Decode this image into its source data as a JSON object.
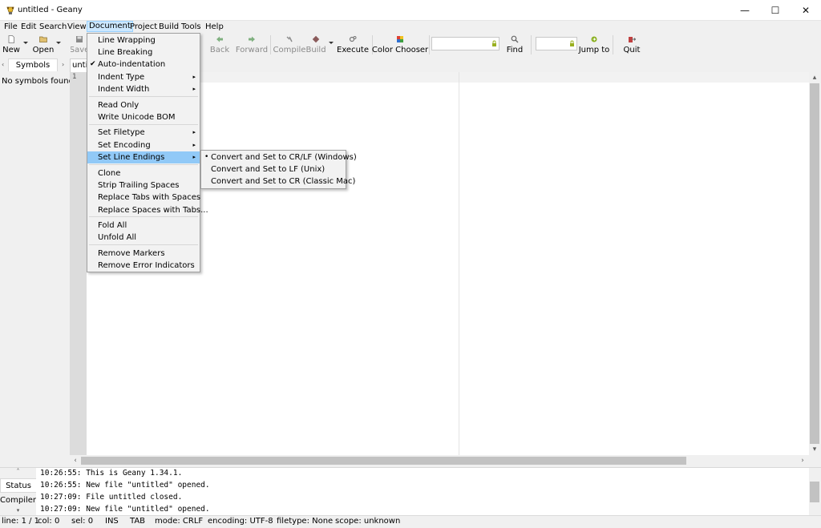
{
  "window": {
    "title": "untitled - Geany",
    "minimize": "—",
    "maximize": "☐",
    "close": "✕"
  },
  "menubar": [
    "File",
    "Edit",
    "Search",
    "View",
    "Document",
    "Project",
    "Build",
    "Tools",
    "Help"
  ],
  "toolbar": {
    "new": "New",
    "open": "Open",
    "save": "Save",
    "back": "Back",
    "forward": "Forward",
    "compile": "Compile",
    "build": "Build",
    "execute": "Execute",
    "color_chooser": "Color Chooser",
    "search_value": "",
    "find": "Find",
    "goto_value": "",
    "jump_to": "Jump to",
    "quit": "Quit"
  },
  "sidebar": {
    "tab": "Symbols",
    "empty_text": "No symbols found"
  },
  "editor": {
    "tab_label": "untitled",
    "line_number": "1"
  },
  "document_menu": {
    "items": [
      {
        "label": "Line Wrapping",
        "checked": false,
        "submenu": false
      },
      {
        "label": "Line Breaking",
        "checked": false,
        "submenu": false
      },
      {
        "label": "Auto-indentation",
        "checked": true,
        "submenu": false
      },
      {
        "label": "Indent Type",
        "checked": false,
        "submenu": true
      },
      {
        "label": "Indent Width",
        "checked": false,
        "submenu": true
      },
      {
        "label": "Read Only",
        "checked": false,
        "submenu": false
      },
      {
        "label": "Write Unicode BOM",
        "checked": false,
        "submenu": false
      },
      {
        "label": "Set Filetype",
        "checked": false,
        "submenu": true
      },
      {
        "label": "Set Encoding",
        "checked": false,
        "submenu": true
      },
      {
        "label": "Set Line Endings",
        "checked": false,
        "submenu": true,
        "highlighted": true
      },
      {
        "label": "Clone",
        "checked": false,
        "submenu": false
      },
      {
        "label": "Strip Trailing Spaces",
        "checked": false,
        "submenu": false
      },
      {
        "label": "Replace Tabs with Spaces",
        "checked": false,
        "submenu": false
      },
      {
        "label": "Replace Spaces with Tabs...",
        "checked": false,
        "submenu": false
      },
      {
        "label": "Fold All",
        "checked": false,
        "submenu": false
      },
      {
        "label": "Unfold All",
        "checked": false,
        "submenu": false
      },
      {
        "label": "Remove Markers",
        "checked": false,
        "submenu": false
      },
      {
        "label": "Remove Error Indicators",
        "checked": false,
        "submenu": false
      }
    ]
  },
  "line_endings_submenu": {
    "items": [
      {
        "label": "Convert and Set to CR/LF (Windows)",
        "selected": true
      },
      {
        "label": "Convert and Set to LF (Unix)",
        "selected": false
      },
      {
        "label": "Convert and Set to CR (Classic Mac)",
        "selected": false
      }
    ]
  },
  "messages": {
    "tabs": {
      "status": "Status",
      "compiler": "Compiler"
    },
    "lines": [
      "10:26:55: This is Geany 1.34.1.",
      "10:26:55: New file \"untitled\" opened.",
      "10:27:09: File untitled closed.",
      "10:27:09: New file \"untitled\" opened."
    ]
  },
  "statusbar": {
    "line": "line: 1 / 1",
    "col": "col: 0",
    "sel": "sel: 0",
    "ins": "INS",
    "tab": "TAB",
    "mode": "mode: CRLF",
    "encoding": "encoding: UTF-8",
    "filetype": "filetype: None",
    "scope": "scope: unknown"
  },
  "colors": {
    "menu_highlight": "#91c9f7",
    "menubar_active": "#cce8ff",
    "gutter": "#dcdcdc"
  },
  "icons": {
    "app": "geany-lamp-icon",
    "new": "new-file-icon",
    "open": "open-folder-icon",
    "save": "save-icon",
    "back": "back-arrow-icon",
    "forward": "forward-arrow-icon",
    "compile": "compile-icon",
    "build": "build-icon",
    "execute": "execute-gears-icon",
    "color_chooser": "color-palette-icon",
    "find": "magnifier-icon",
    "jump_to": "jump-arrow-icon",
    "quit": "quit-icon"
  }
}
